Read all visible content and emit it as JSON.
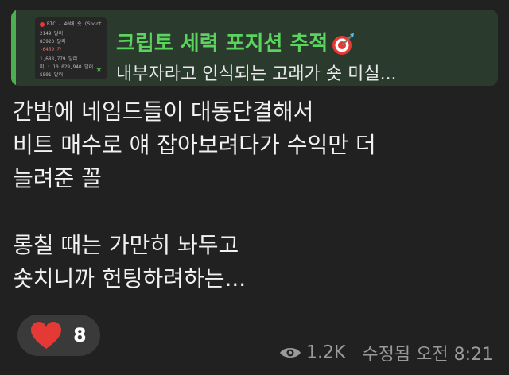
{
  "reply": {
    "title": "크립토 세력 포지션 추적",
    "text": "내부자라고 인식되는 고래가 숏 미실...",
    "thumb_lines": [
      "BTC - 40배 숏 (Short",
      "2149 달러",
      "83923 달러",
      "-6459 가",
      "1,688,779 달러",
      "미 : 10,029,940 달러",
      "S801 달러"
    ]
  },
  "message": {
    "lines": [
      "간밤에 네임드들이 대동단결해서",
      "비트 매수로 얘 잡아보려다가 수익만 더",
      "늘려준 꼴",
      "",
      "롱칠 때는 가만히 놔두고",
      "숏치니까 헌팅하려하는..."
    ]
  },
  "reaction": {
    "emoji": "heart",
    "count": "8"
  },
  "meta": {
    "views": "1.2K",
    "status": "수정됨 오전 8:21"
  },
  "colors": {
    "accent": "#4caf50",
    "title": "#5bd35f",
    "heart": "#e53935"
  }
}
